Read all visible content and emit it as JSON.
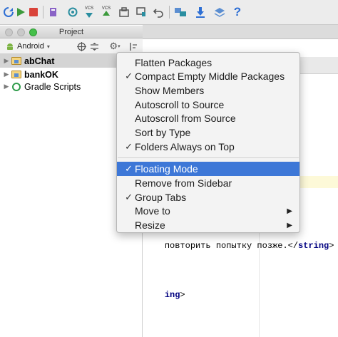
{
  "window": {
    "title": "Project"
  },
  "toolbar": {
    "icons": [
      "refresh-icon",
      "run-icon",
      "stop-icon",
      "build-icon",
      "sync-icon",
      "vcs-update-icon",
      "vcs-commit-icon",
      "sdk-manager-icon",
      "avd-manager-icon",
      "undo-icon",
      "structure-icon",
      "download-icon",
      "layers-icon",
      "help-icon"
    ],
    "vcs_label": "VCS",
    "help_glyph": "?"
  },
  "project_panel": {
    "view_selector": "Android",
    "tree": [
      {
        "label": "abChat",
        "bold": true,
        "type": "module",
        "selected": true
      },
      {
        "label": "bankOK",
        "bold": true,
        "type": "module",
        "selected": false
      },
      {
        "label": "Gradle Scripts",
        "bold": false,
        "type": "gradle",
        "selected": false
      }
    ]
  },
  "editor": {
    "code_lines": [
      {
        "text": "повторить попытку позже.</",
        "tag": "string",
        "suffix": ">"
      },
      {
        "text": "",
        "tag": "ing",
        "suffix": ">"
      }
    ]
  },
  "context_menu": {
    "items": [
      {
        "label": "Flatten Packages",
        "checked": false
      },
      {
        "label": "Compact Empty Middle Packages",
        "checked": true
      },
      {
        "label": "Show Members",
        "checked": false
      },
      {
        "label": "Autoscroll to Source",
        "checked": false
      },
      {
        "label": "Autoscroll from Source",
        "checked": false
      },
      {
        "label": "Sort by Type",
        "checked": false
      },
      {
        "label": "Folders Always on Top",
        "checked": true
      },
      {
        "label": "Floating Mode",
        "checked": true,
        "highlighted": true
      },
      {
        "label": "Remove from Sidebar",
        "checked": false
      },
      {
        "label": "Group Tabs",
        "checked": true
      },
      {
        "label": "Move to",
        "checked": false,
        "submenu": true
      },
      {
        "label": "Resize",
        "checked": false,
        "submenu": true
      }
    ],
    "check_glyph": "✓",
    "submenu_glyph": "▶"
  },
  "colors": {
    "highlight": "#3d77d7",
    "stop_red": "#d9433a",
    "run_green": "#3c9a3c",
    "vcs_teal": "#2a8ea0",
    "help_blue": "#2e6fd4"
  }
}
